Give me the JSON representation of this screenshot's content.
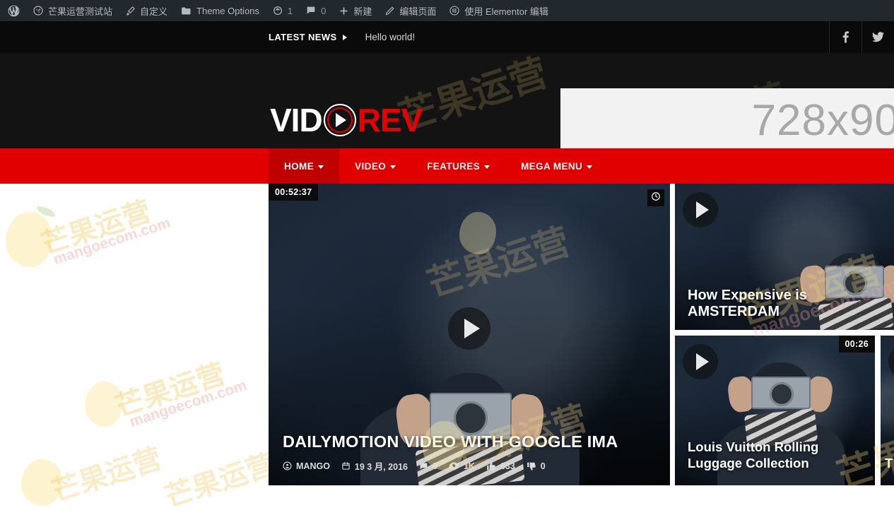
{
  "adminbar": {
    "items": [
      {
        "icon": "wordpress-logo-icon",
        "label": ""
      },
      {
        "icon": "dashboard-gauge-icon",
        "label": "芒果运营测试站"
      },
      {
        "icon": "customize-brush-icon",
        "label": "自定义"
      },
      {
        "icon": "theme-options-folder-icon",
        "label": "Theme Options"
      },
      {
        "icon": "updates-refresh-icon",
        "label": "1"
      },
      {
        "icon": "comments-bubble-icon",
        "label": "0"
      },
      {
        "icon": "new-plus-icon",
        "label": "新建"
      },
      {
        "icon": "edit-pencil-icon",
        "label": "编辑页面"
      },
      {
        "icon": "elementor-icon",
        "label": "使用 Elementor 编辑"
      }
    ]
  },
  "topbar": {
    "latest_news_label": "LATEST NEWS",
    "latest_news_item": "Hello world!",
    "social": [
      {
        "name": "facebook-icon"
      },
      {
        "name": "twitter-icon"
      }
    ]
  },
  "logo": {
    "part_one": "VID",
    "part_two": "REV",
    "play_icon": "play-circle-icon"
  },
  "ad": {
    "size_label": "728x90"
  },
  "nav": {
    "items": [
      {
        "label": "HOME",
        "active": true,
        "has_dropdown": true
      },
      {
        "label": "VIDEO",
        "active": false,
        "has_dropdown": true
      },
      {
        "label": "FEATURES",
        "active": false,
        "has_dropdown": true
      },
      {
        "label": "MEGA MENU",
        "active": false,
        "has_dropdown": true
      }
    ]
  },
  "featured": {
    "duration": "00:52:37",
    "watch_later_icon": "clock-icon",
    "play_icon": "play-icon",
    "title": "DAILYMOTION VIDEO WITH GOOGLE IMA",
    "meta": {
      "author": "MANGO",
      "date": "19 3 月, 2016",
      "comments": "0",
      "views": "1K",
      "likes": "633",
      "dislikes": "0"
    }
  },
  "side_cards": [
    {
      "title": "How Expensive is AMSTERDAM",
      "duration": "",
      "play_icon": "play-icon"
    },
    {
      "title": "Louis Vuitton Rolling Luggage Collection",
      "duration": "00:26",
      "play_icon": "play-icon"
    },
    {
      "title": "T",
      "duration": "",
      "play_icon": "play-icon"
    }
  ],
  "watermark": {
    "cn": "芒果运营",
    "en": "mangoecom.com"
  },
  "colors": {
    "brand_red": "#e00000",
    "nav_active_red": "#c00000",
    "header_black": "#131313",
    "adminbar": "#23282d",
    "ad_bg": "#f2f2f2"
  }
}
